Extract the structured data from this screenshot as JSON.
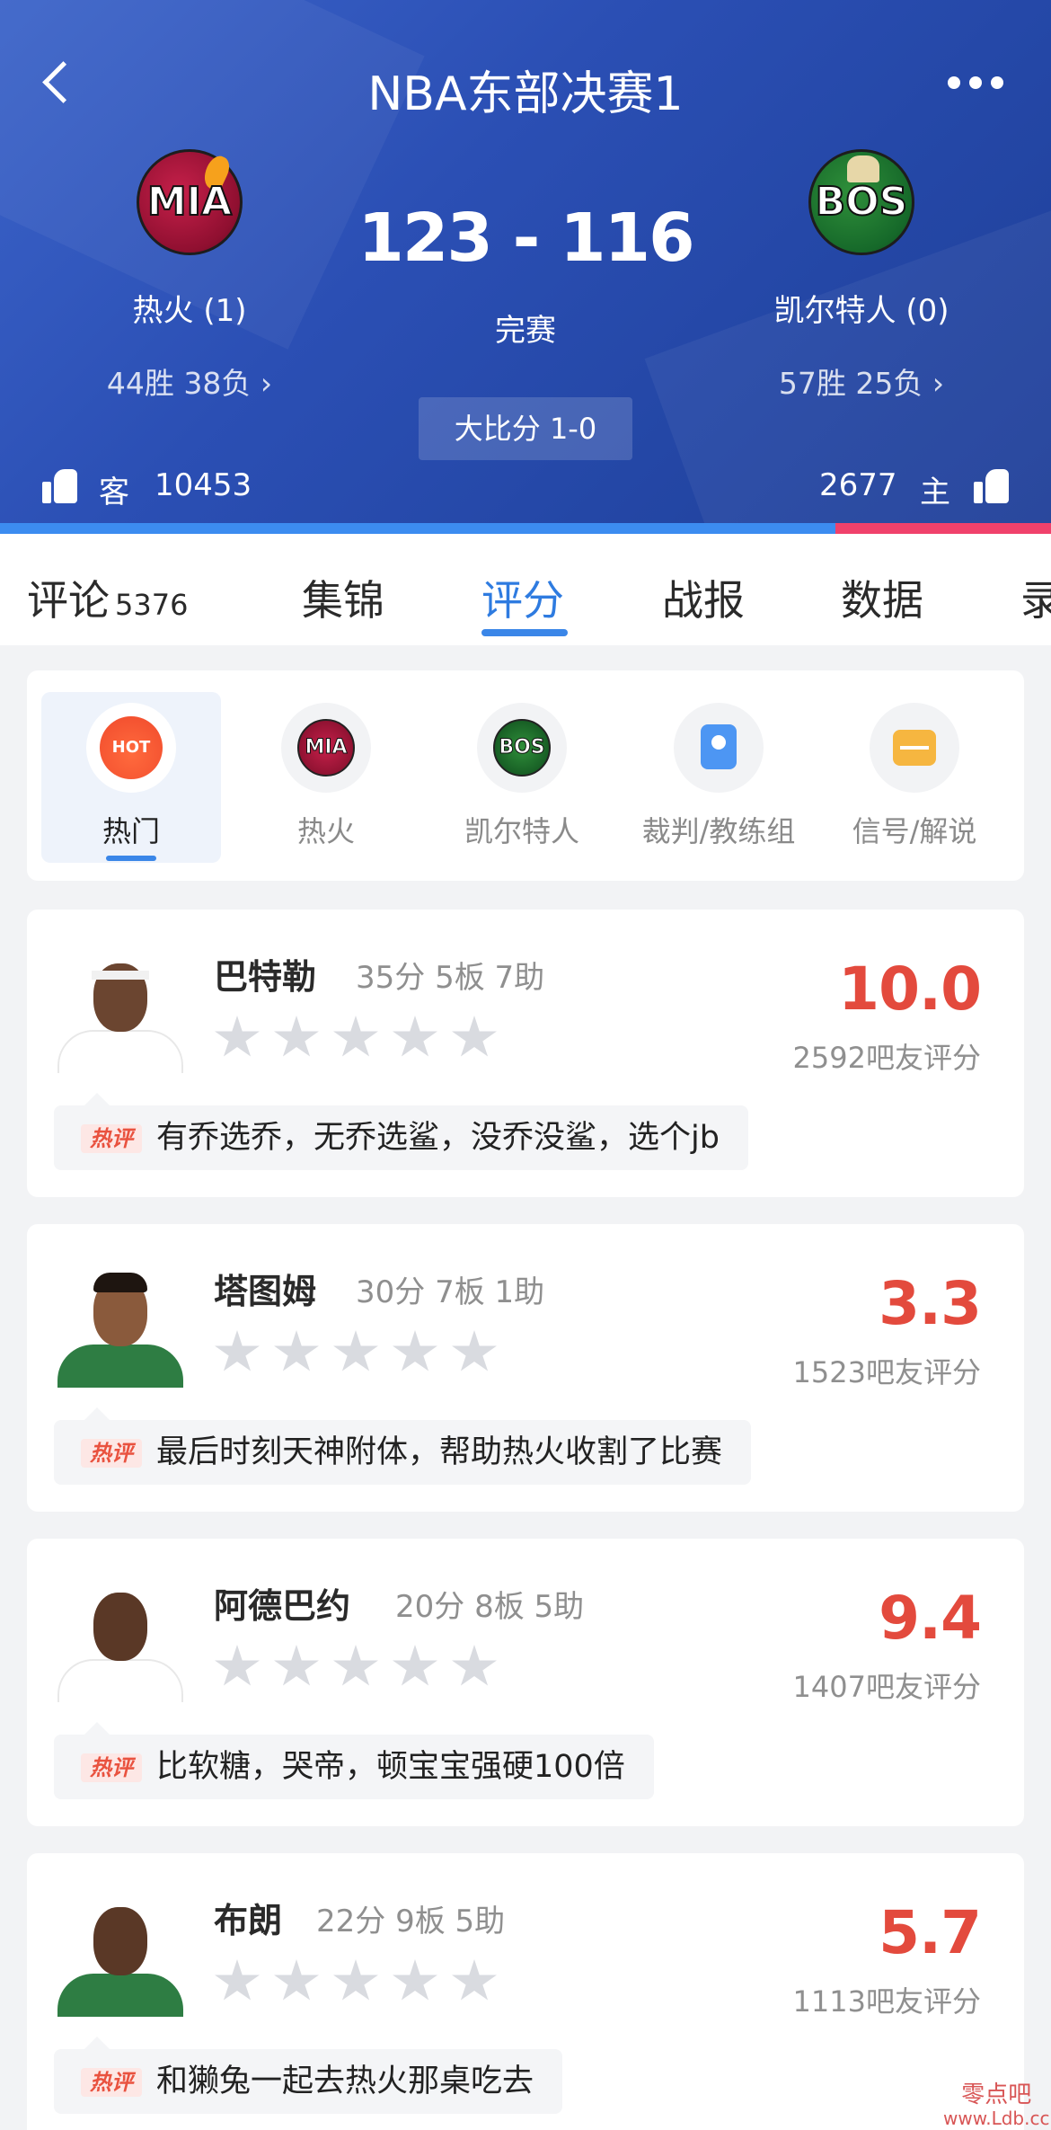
{
  "header": {
    "title": "NBA东部决赛1",
    "score": "123 - 116",
    "status": "完赛",
    "series": "大比分 1-0",
    "home_team": {
      "name": "热火 (1)",
      "record": "44胜 38负 ›",
      "logo_text": "MIA"
    },
    "away_team": {
      "name": "凯尔特人 (0)",
      "record": "57胜 25负 ›",
      "logo_text": "BOS"
    },
    "votes_left": {
      "label": "客",
      "count": "10453"
    },
    "votes_right": {
      "label": "主",
      "count": "2677"
    },
    "vote_share_left": 0.795,
    "colors": {
      "left_bar": "#3c8cf0",
      "right_bar": "#f0416b"
    }
  },
  "tabs": [
    {
      "label": "评论",
      "count": "5376"
    },
    {
      "label": "集锦"
    },
    {
      "label": "评分"
    },
    {
      "label": "战报"
    },
    {
      "label": "数据"
    },
    {
      "label": "录"
    }
  ],
  "filters": [
    {
      "label": "热门",
      "icon": "hot-icon",
      "badge": "HOT"
    },
    {
      "label": "热火",
      "icon": "heat-logo-icon",
      "badge": "MIA"
    },
    {
      "label": "凯尔特人",
      "icon": "celtics-logo-icon",
      "badge": "BOS"
    },
    {
      "label": "裁判/教练组",
      "icon": "referee-icon"
    },
    {
      "label": "信号/解说",
      "icon": "broadcast-icon"
    }
  ],
  "players": [
    {
      "name": "巴特勒",
      "stats": "35分 5板 7助",
      "rating": "10.0",
      "votes": "2592吧友评分",
      "hot_tag": "热评",
      "comment": "有乔选乔，无乔选鲨，没乔没鲨，选个jb",
      "jersey_color": "#ffffff"
    },
    {
      "name": "塔图姆",
      "stats": "30分 7板 1助",
      "rating": "3.3",
      "votes": "1523吧友评分",
      "hot_tag": "热评",
      "comment": "最后时刻天神附体，帮助热火收割了比赛",
      "jersey_color": "#2e7d43"
    },
    {
      "name": "阿德巴约",
      "stats": "20分 8板 5助",
      "rating": "9.4",
      "votes": "1407吧友评分",
      "hot_tag": "热评",
      "comment": "比软糖，哭帝，顿宝宝强硬100倍",
      "jersey_color": "#ffffff"
    },
    {
      "name": "布朗",
      "stats": "22分 9板 5助",
      "rating": "5.7",
      "votes": "1113吧友评分",
      "hot_tag": "热评",
      "comment": "和獭兔一起去热火那桌吃去",
      "jersey_color": "#2e7d43"
    }
  ],
  "watermark": {
    "line1": "零点吧",
    "line2": "www.Ldb.cc"
  }
}
